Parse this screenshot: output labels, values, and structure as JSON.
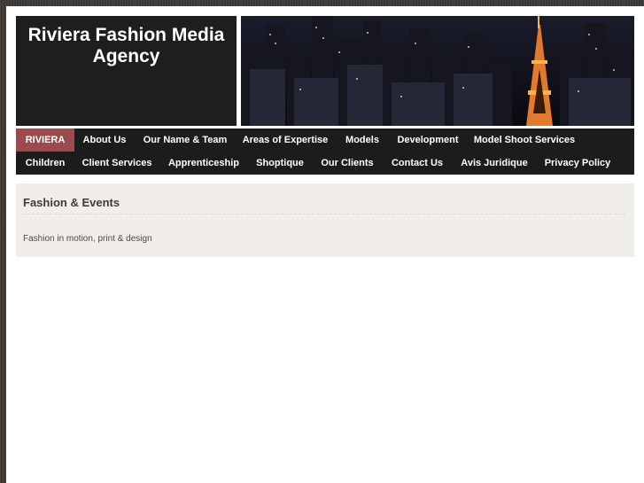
{
  "site": {
    "title": "Riviera Fashion Media Agency"
  },
  "banner": {
    "description_icon": "city-night-skyline-image"
  },
  "nav": {
    "row1": [
      {
        "label": "RIVIERA",
        "active": true
      },
      {
        "label": "About Us"
      },
      {
        "label": "Our Name & Team"
      },
      {
        "label": "Areas of Expertise"
      },
      {
        "label": "Models"
      },
      {
        "label": "Development"
      },
      {
        "label": "Model Shoot Services"
      }
    ],
    "row2": [
      {
        "label": "Children"
      },
      {
        "label": "Client Services"
      },
      {
        "label": "Apprenticeship"
      },
      {
        "label": "Shoptique"
      },
      {
        "label": "Our Clients"
      },
      {
        "label": "Contact Us"
      },
      {
        "label": "Avis Juridique"
      },
      {
        "label": "Privacy Policy"
      }
    ]
  },
  "content": {
    "heading": "Fashion & Events",
    "text": "Fashion in motion, print & design"
  },
  "colors": {
    "background": "#3f3a36",
    "nav_bg": "#1c1c1c",
    "active": "#9c4a4c",
    "content_bg": "#f1eeea"
  }
}
